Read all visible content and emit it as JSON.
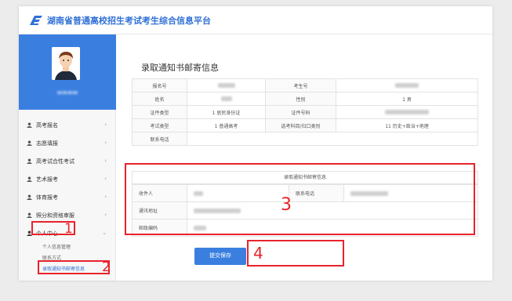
{
  "header": {
    "site_title": "湖南省普通高校招生考试考生综合信息平台"
  },
  "sidebar": {
    "menu": [
      {
        "label": "高考报名"
      },
      {
        "label": "志愿填报"
      },
      {
        "label": "高考试合性考试"
      },
      {
        "label": "艺术报考"
      },
      {
        "label": "体育报考"
      },
      {
        "label": "照分和资格审服"
      },
      {
        "label": "个人中心"
      }
    ],
    "sub_items": [
      "个人信息管理",
      "联系方式",
      "录取通知书邮寄信息"
    ]
  },
  "main": {
    "page_title": "录取通知书邮寄信息",
    "info_rows": [
      [
        "报名号",
        "",
        "考生号",
        ""
      ],
      [
        "姓名",
        "",
        "性别",
        "1 男"
      ],
      [
        "证件类型",
        "1 居民身份证",
        "证件号码",
        ""
      ],
      [
        "考试类型",
        "1 普通高考",
        "选考科目/归口类别",
        "11 历史+政治+地理"
      ],
      [
        "联系电话",
        "",
        "",
        ""
      ]
    ],
    "mail_title": "录取通知书邮寄信息",
    "mail_rows": [
      {
        "label": "收件人",
        "label2": "联系电话"
      },
      {
        "label": "通讯地址"
      },
      {
        "label": "邮政编码"
      }
    ],
    "submit_label": "提交保存"
  },
  "annotations": [
    "1",
    "2",
    "3",
    "4"
  ]
}
